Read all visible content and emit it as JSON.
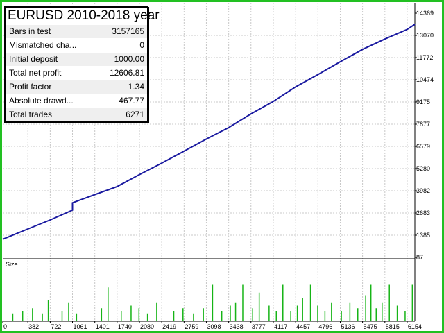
{
  "panel": {
    "title": "EURUSD 2010-2018 year",
    "rows": [
      {
        "label": "Bars in test",
        "value": "3157165"
      },
      {
        "label": "Mismatched cha...",
        "value": "0"
      },
      {
        "label": "Initial deposit",
        "value": "1000.00"
      },
      {
        "label": "Total net profit",
        "value": "12606.81"
      },
      {
        "label": "Profit factor",
        "value": "1.34"
      },
      {
        "label": "Absolute drawd...",
        "value": "467.77"
      },
      {
        "label": "Total trades",
        "value": "6271"
      }
    ]
  },
  "colors": {
    "frame": "#22c022",
    "balance_line": "#1a1aa0",
    "volume_bars": "#16b416",
    "grid": "#c8c8c8"
  },
  "chart_data": [
    {
      "type": "line",
      "name": "balance",
      "ylim": [
        87,
        14369
      ],
      "y_ticks": [
        "14369",
        "13070",
        "11772",
        "10474",
        "9175",
        "7877",
        "6579",
        "5280",
        "3982",
        "2683",
        "1385",
        "87"
      ],
      "xlim": [
        0,
        6271
      ],
      "x": [
        0,
        382,
        722,
        1061,
        1061,
        1401,
        1740,
        2080,
        2419,
        2759,
        3098,
        3438,
        3777,
        4117,
        4457,
        4796,
        5136,
        5475,
        5815,
        6154,
        6271
      ],
      "y": [
        1150,
        1750,
        2280,
        2850,
        3280,
        3760,
        4230,
        4930,
        5600,
        6300,
        7010,
        7680,
        8480,
        9210,
        10060,
        10780,
        11530,
        12250,
        12860,
        13420,
        13720
      ],
      "grid": true
    },
    {
      "type": "bar",
      "title": "Size",
      "x_ticks": [
        "0",
        "382",
        "722",
        "1061",
        "1401",
        "1740",
        "2080",
        "2419",
        "2759",
        "3098",
        "3438",
        "3777",
        "4117",
        "4457",
        "4796",
        "5136",
        "5475",
        "5815",
        "6154"
      ],
      "xlim": [
        0,
        6271
      ],
      "ylim": [
        0,
        1
      ],
      "x": [
        150,
        300,
        450,
        600,
        690,
        900,
        1000,
        1120,
        1500,
        1600,
        1800,
        1950,
        2070,
        2200,
        2340,
        2600,
        2740,
        2900,
        3050,
        3190,
        3330,
        3460,
        3540,
        3650,
        3800,
        3900,
        4050,
        4160,
        4260,
        4380,
        4480,
        4560,
        4680,
        4790,
        4900,
        5000,
        5150,
        5280,
        5400,
        5520,
        5600,
        5680,
        5770,
        5880,
        6000,
        6120,
        6230
      ],
      "values": [
        0.15,
        0.2,
        0.25,
        0.15,
        0.4,
        0.2,
        0.35,
        0.15,
        0.25,
        0.65,
        0.2,
        0.3,
        0.25,
        0.15,
        0.35,
        0.2,
        0.25,
        0.15,
        0.25,
        0.7,
        0.2,
        0.3,
        0.35,
        0.7,
        0.25,
        0.55,
        0.3,
        0.2,
        0.7,
        0.2,
        0.3,
        0.45,
        0.7,
        0.3,
        0.2,
        0.35,
        0.2,
        0.35,
        0.25,
        0.5,
        0.7,
        0.25,
        0.35,
        0.7,
        0.3,
        0.2,
        0.7
      ],
      "grid": true
    }
  ]
}
